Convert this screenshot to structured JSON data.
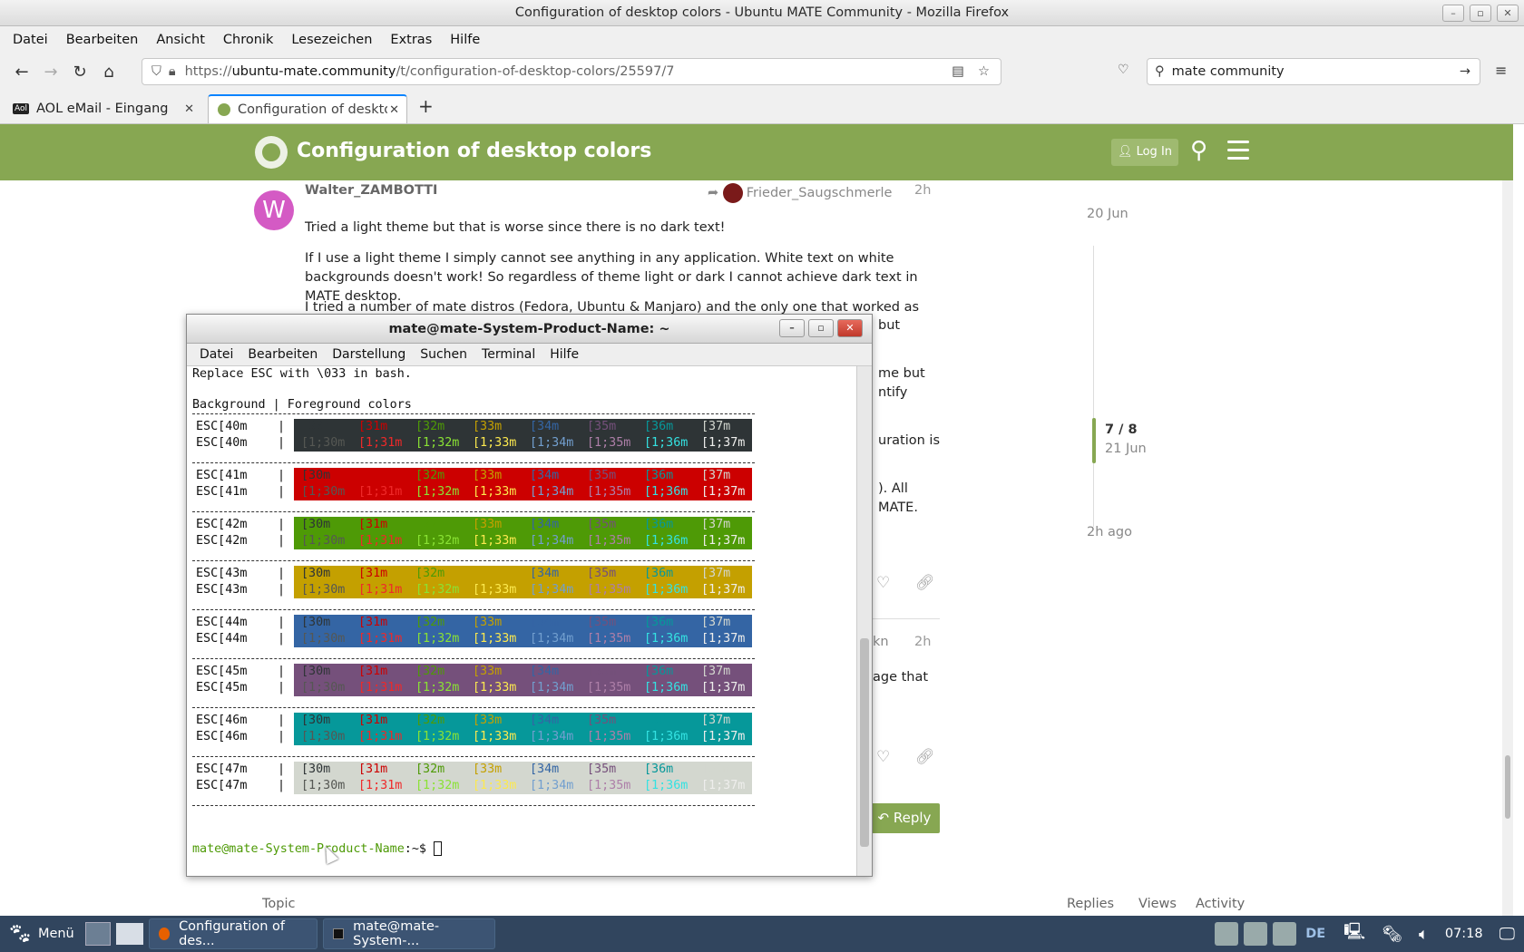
{
  "browser": {
    "window_title": "Configuration of desktop colors - Ubuntu MATE Community - Mozilla Firefox",
    "menu": [
      "Datei",
      "Bearbeiten",
      "Ansicht",
      "Chronik",
      "Lesezeichen",
      "Extras",
      "Hilfe"
    ],
    "url_prefix": "https://",
    "url_host": "ubuntu-mate.community",
    "url_path": "/t/configuration-of-desktop-colors/25597/7",
    "search_value": "mate community",
    "tabs": [
      {
        "label": "AOL eMail - Eingang"
      },
      {
        "label": "Configuration of desktop"
      }
    ]
  },
  "discourse": {
    "topic_title": "Configuration of desktop colors",
    "login_label": "Log In",
    "post": {
      "username": "Walter_ZAMBOTTI",
      "avatar_letter": "W",
      "reply_to": "Frieder_Saugschmerle",
      "time": "2h",
      "p1": "Tried a light theme but that is worse since there is no dark text!",
      "p2": "If I use a light theme I simply cannot see anything in any application. White text on white backgrounds doesn't work! So regardless of theme light or dark I cannot achieve dark text in MATE desktop.",
      "p3": "I tried a number of mate distros (Fedora, Ubuntu & Manjaro) and the only one that worked as",
      "fragments": [
        "but",
        "me but",
        "ntify",
        "uration is",
        "). All",
        "MATE.",
        "kn",
        "2h",
        "age that"
      ]
    },
    "reply_label": "Reply",
    "timeline": {
      "start": "20 Jun",
      "position": "7 / 8",
      "position_date": "21 Jun",
      "end": "2h ago"
    },
    "list_headers": {
      "topic": "Topic",
      "replies": "Replies",
      "views": "Views",
      "activity": "Activity"
    }
  },
  "terminal": {
    "title": "mate@mate-System-Product-Name: ~",
    "menu": [
      "Datei",
      "Bearbeiten",
      "Darstellung",
      "Suchen",
      "Terminal",
      "Hilfe"
    ],
    "line1": "Replace ESC with \\033 in bash.",
    "line2": "Background | Foreground colors",
    "prompt_user": "mate@mate-System-Product-Name",
    "prompt_path": ":~$ ",
    "rows": [
      {
        "bg": "#2e3436",
        "esc": "ESC[40m",
        "r1": [
          "[30m",
          "[31m",
          "[32m",
          "[33m",
          "[34m",
          "[35m",
          "[36m",
          "[37m"
        ],
        "r2": [
          "[1;30m",
          "[1;31m",
          "[1;32m",
          "[1;33m",
          "[1;34m",
          "[1;35m",
          "[1;36m",
          "[1;37m"
        ]
      },
      {
        "bg": "#cc0000",
        "esc": "ESC[41m",
        "r1": [
          "[30m",
          "[31m",
          "[32m",
          "[33m",
          "[34m",
          "[35m",
          "[36m",
          "[37m"
        ],
        "r2": [
          "[1;30m",
          "[1;31m",
          "[1;32m",
          "[1;33m",
          "[1;34m",
          "[1;35m",
          "[1;36m",
          "[1;37m"
        ]
      },
      {
        "bg": "#4e9a06",
        "esc": "ESC[42m",
        "r1": [
          "[30m",
          "[31m",
          "[32m",
          "[33m",
          "[34m",
          "[35m",
          "[36m",
          "[37m"
        ],
        "r2": [
          "[1;30m",
          "[1;31m",
          "[1;32m",
          "[1;33m",
          "[1;34m",
          "[1;35m",
          "[1;36m",
          "[1;37m"
        ]
      },
      {
        "bg": "#c4a000",
        "esc": "ESC[43m",
        "r1": [
          "[30m",
          "[31m",
          "[32m",
          "[33m",
          "[34m",
          "[35m",
          "[36m",
          "[37m"
        ],
        "r2": [
          "[1;30m",
          "[1;31m",
          "[1;32m",
          "[1;33m",
          "[1;34m",
          "[1;35m",
          "[1;36m",
          "[1;37m"
        ]
      },
      {
        "bg": "#3465a4",
        "esc": "ESC[44m",
        "r1": [
          "[30m",
          "[31m",
          "[32m",
          "[33m",
          "[34m",
          "[35m",
          "[36m",
          "[37m"
        ],
        "r2": [
          "[1;30m",
          "[1;31m",
          "[1;32m",
          "[1;33m",
          "[1;34m",
          "[1;35m",
          "[1;36m",
          "[1;37m"
        ]
      },
      {
        "bg": "#75507b",
        "esc": "ESC[45m",
        "r1": [
          "[30m",
          "[31m",
          "[32m",
          "[33m",
          "[34m",
          "[35m",
          "[36m",
          "[37m"
        ],
        "r2": [
          "[1;30m",
          "[1;31m",
          "[1;32m",
          "[1;33m",
          "[1;34m",
          "[1;35m",
          "[1;36m",
          "[1;37m"
        ]
      },
      {
        "bg": "#06989a",
        "esc": "ESC[46m",
        "r1": [
          "[30m",
          "[31m",
          "[32m",
          "[33m",
          "[34m",
          "[35m",
          "[36m",
          "[37m"
        ],
        "r2": [
          "[1;30m",
          "[1;31m",
          "[1;32m",
          "[1;33m",
          "[1;34m",
          "[1;35m",
          "[1;36m",
          "[1;37m"
        ]
      },
      {
        "bg": "#d3d7cf",
        "esc": "ESC[47m",
        "r1": [
          "[30m",
          "[31m",
          "[32m",
          "[33m",
          "[34m",
          "[35m",
          "[36m",
          "[37m"
        ],
        "r2": [
          "[1;30m",
          "[1;31m",
          "[1;32m",
          "[1;33m",
          "[1;34m",
          "[1;35m",
          "[1;36m",
          "[1;37m"
        ]
      }
    ],
    "fg_normal": [
      "#2e3436",
      "#cc0000",
      "#4e9a06",
      "#c4a000",
      "#3465a4",
      "#75507b",
      "#06989a",
      "#d3d7cf"
    ],
    "fg_bold": [
      "#555753",
      "#ef2929",
      "#8ae234",
      "#fce94f",
      "#729fcf",
      "#ad7fa8",
      "#34e2e2",
      "#eeeeec"
    ]
  },
  "taskbar": {
    "menu_label": "Menü",
    "apps": [
      "Configuration of des...",
      "mate@mate-System-..."
    ],
    "keyboard": "DE",
    "clock": "07:18"
  }
}
